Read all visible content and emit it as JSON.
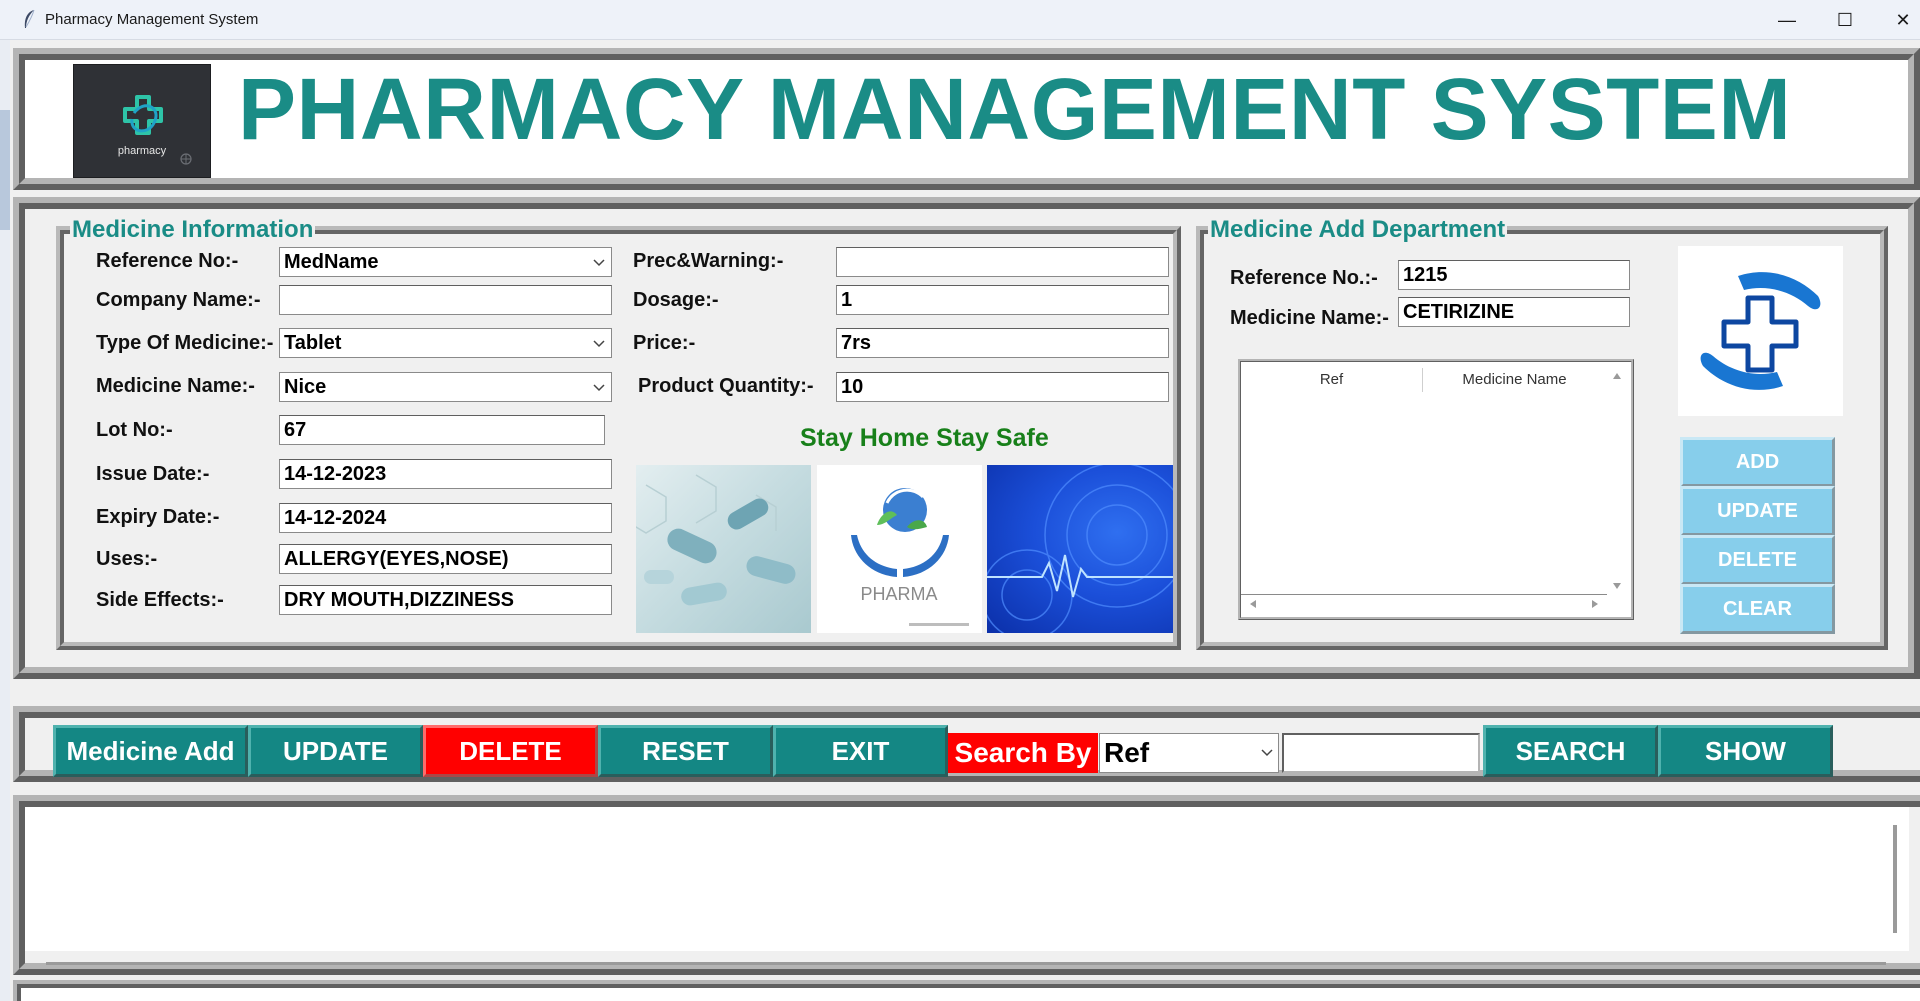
{
  "window": {
    "title": "Pharmacy Management System",
    "minimize": "—",
    "maximize": "☐",
    "close": "✕"
  },
  "header": {
    "logo_text": "pharmacy",
    "title": "PHARMACY MANAGEMENT SYSTEM"
  },
  "medicine_info": {
    "frame_title": "Medicine Information",
    "reference_no": {
      "label": "Reference No:-",
      "value": "MedName"
    },
    "company_name": {
      "label": "Company Name:-",
      "value": ""
    },
    "type_of_medicine": {
      "label": "Type Of Medicine:-",
      "value": "Tablet"
    },
    "medicine_name": {
      "label": "Medicine Name:-",
      "value": "Nice"
    },
    "lot_no": {
      "label": "Lot No:-",
      "value": "67"
    },
    "issue_date": {
      "label": "Issue Date:-",
      "value": "14-12-2023"
    },
    "expiry_date": {
      "label": "Expiry Date:-",
      "value": "14-12-2024"
    },
    "uses": {
      "label": "Uses:-",
      "value": "ALLERGY(EYES,NOSE)"
    },
    "side_effects": {
      "label": "Side Effects:-",
      "value": "DRY MOUTH,DIZZINESS"
    },
    "prec_warning": {
      "label": "Prec&Warning:-",
      "value": ""
    },
    "dosage": {
      "label": "Dosage:-",
      "value": "1"
    },
    "price": {
      "label": "Price:-",
      "value": "7rs"
    },
    "product_quantity": {
      "label": "Product Quantity:-",
      "value": "10"
    },
    "slogan": "Stay Home Stay Safe",
    "pharma_image_text": "PHARMA"
  },
  "add_department": {
    "frame_title": "Medicine Add Department",
    "reference_no": {
      "label": "Reference No.:-",
      "value": "1215"
    },
    "medicine_name": {
      "label": "Medicine Name:-",
      "value": "CETIRIZINE"
    },
    "table_headers": [
      "Ref",
      "Medicine Name"
    ],
    "buttons": {
      "add": "ADD",
      "update": "UPDATE",
      "delete": "DELETE",
      "clear": "CLEAR"
    }
  },
  "toolbar": {
    "medicine_add": "Medicine Add",
    "update": "UPDATE",
    "delete": "DELETE",
    "reset": "RESET",
    "exit": "EXIT",
    "search_by_label": "Search By",
    "search_by_value": "Ref",
    "search_value": "",
    "search": "SEARCH",
    "show": "SHOW"
  },
  "colors": {
    "teal": "#148784",
    "title_teal": "#1a8c86",
    "red": "#ff0000",
    "sky_blue": "#87ceeb",
    "slogan_green": "#18801a"
  }
}
